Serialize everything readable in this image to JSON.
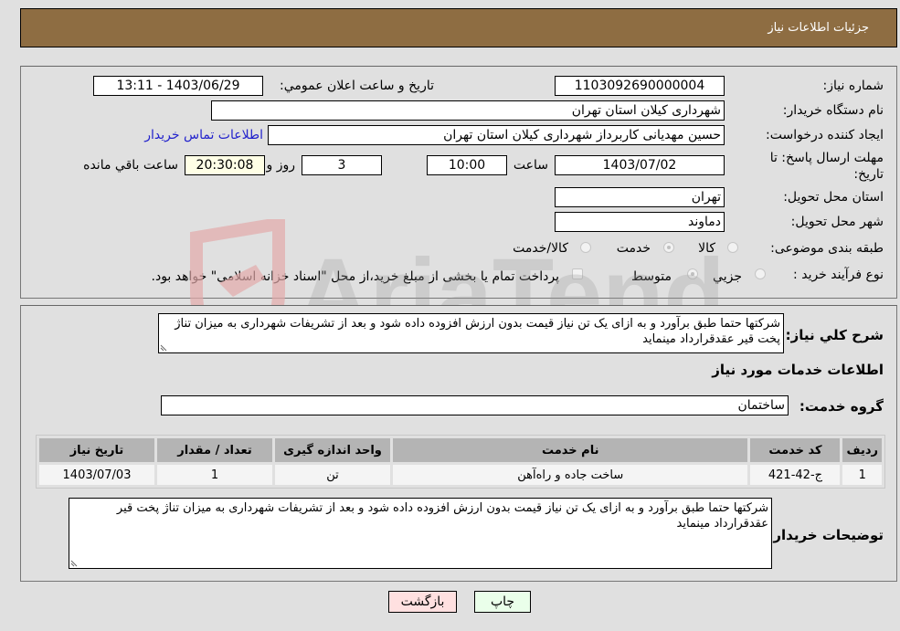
{
  "header": {
    "title": "جزئیات اطلاعات نیاز"
  },
  "form": {
    "need_number": {
      "label": "شماره نیاز:",
      "value": "1103092690000004"
    },
    "announce_datetime": {
      "label": "تاريخ و ساعت اعلان عمومي:",
      "value": "1403/06/29 - 13:11"
    },
    "buyer_org": {
      "label": "نام دستگاه خريدار:",
      "value": "شهرداری کیلان استان تهران"
    },
    "requester": {
      "label": "ايجاد کننده درخواست:",
      "value": "حسین مهدیانی کاربرداز شهرداری کیلان استان تهران"
    },
    "buyer_contact_link": "اطلاعات تماس خريدار",
    "deadline": {
      "label_line1": "مهلت ارسال پاسخ: تا",
      "label_line2": "تاريخ:",
      "date": "1403/07/02",
      "time_label": "ساعت",
      "time": "10:00",
      "days": "3",
      "days_label": "روز و",
      "remaining": "20:30:08",
      "remaining_label": "ساعت باقي مانده"
    },
    "delivery_province": {
      "label": "استان محل تحويل:",
      "value": "تهران"
    },
    "delivery_city": {
      "label": "شهر محل تحويل:",
      "value": "دماوند"
    },
    "category": {
      "label": "طبقه بندی موضوعی:",
      "options": [
        "کالا",
        "خدمت",
        "کالا/خدمت"
      ],
      "selected": "خدمت"
    },
    "purchase_type": {
      "label": "نوع فرآيند خريد :",
      "options": [
        "جزيي",
        "متوسط"
      ],
      "selected": "متوسط",
      "treasury_note": "پرداخت تمام يا بخشی از مبلغ خريد،از محل \"اسناد خزانه اسلامی\" خواهد بود."
    }
  },
  "details": {
    "summary_label": "شرح کلي نياز:",
    "summary_text": "شرکتها حتما طبق برآورد و به ازای یک تن نیاز قیمت بدون ارزش افزوده داده شود و بعد از تشریفات شهرداری به میزان تناژ پخت قیر عقدقرارداد مینماید",
    "services_heading": "اطلاعات خدمات مورد نياز",
    "service_group_label": "گروه خدمت:",
    "service_group_value": "ساختمان",
    "table": {
      "headers": [
        "رديف",
        "کد خدمت",
        "نام خدمت",
        "واحد اندازه گيری",
        "تعداد / مقدار",
        "تاريخ نياز"
      ],
      "rows": [
        [
          "1",
          "ج-42-421",
          "ساخت جاده و راه‌آهن",
          "تن",
          "1",
          "1403/07/03"
        ]
      ]
    },
    "buyer_notes_label": "توضيحات خريدار:",
    "buyer_notes_text": "شرکتها حتما طبق برآورد و به ازای یک تن نیاز قیمت بدون ارزش افزوده داده شود و بعد از تشریفات شهرداری به میزان تناژ پخت قیر عقدقرارداد مینماید"
  },
  "buttons": {
    "print": "چاپ",
    "back": "بازگشت"
  },
  "watermark": {
    "text": "AriaTender.neT"
  },
  "colors": {
    "header_bg": "#8e6d42",
    "link": "#2222cc",
    "print_bg": "#eaffea",
    "back_bg": "#ffe0e0",
    "remaining_bg": "#ffffe6"
  }
}
